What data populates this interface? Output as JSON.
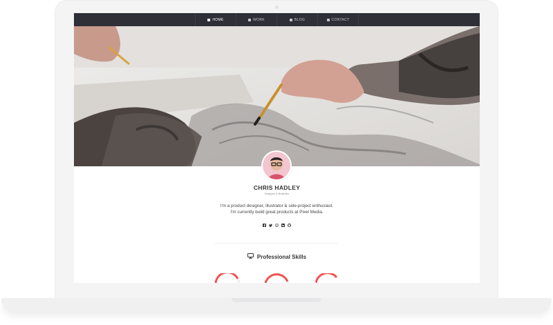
{
  "nav": {
    "items": [
      {
        "label": "HOME",
        "icon": "home-icon",
        "active": true
      },
      {
        "label": "WORK",
        "icon": "briefcase-icon",
        "active": false
      },
      {
        "label": "BLOG",
        "icon": "blog-icon",
        "active": false
      },
      {
        "label": "CONTACT",
        "icon": "envelope-icon",
        "active": false
      }
    ]
  },
  "profile": {
    "name": "CHRIS HADLEY",
    "role": "Designer & Illustrator",
    "bio_line1": "I'm a product designer, illustrator & side-project enthusiast.",
    "bio_line2": "I'm currently build great products at Pixel Media."
  },
  "socials": [
    {
      "icon": "facebook-icon"
    },
    {
      "icon": "twitter-icon"
    },
    {
      "icon": "pinterest-icon"
    },
    {
      "icon": "linkedin-icon"
    },
    {
      "icon": "github-icon"
    }
  ],
  "skills": {
    "title": "Professional Skills",
    "icon": "monitor-icon"
  },
  "colors": {
    "nav_bg": "#2f2f38",
    "accent": "#ef5350"
  }
}
